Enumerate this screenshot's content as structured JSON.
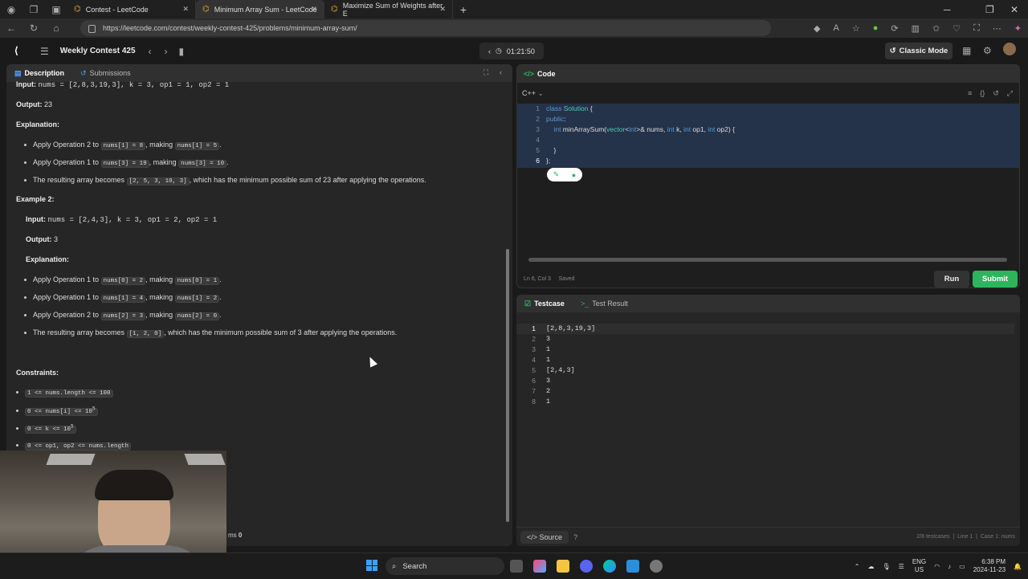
{
  "browser": {
    "tabs": [
      {
        "title": "Contest - LeetCode"
      },
      {
        "title": "Minimum Array Sum - LeetCode"
      },
      {
        "title": "Maximize Sum of Weights after E"
      }
    ],
    "url": "https://leetcode.com/contest/weekly-contest-425/problems/minimum-array-sum/"
  },
  "header": {
    "contest_title": "Weekly Contest 425",
    "timer": "01:21:50",
    "classic_mode_label": "Classic Mode"
  },
  "left_panel": {
    "tab_description": "Description",
    "tab_submissions": "Submissions",
    "top_input_label": "Input:",
    "top_input_value": "nums = [2,8,3,19,3], k = 3, op1 = 1, op2 = 1",
    "output1_label": "Output:",
    "output1_value": "23",
    "explanation_label": "Explanation:",
    "ex1_items": [
      {
        "a": "Apply Operation 2 to ",
        "c1": "nums[1] = 8",
        "b": ", making ",
        "c2": "nums[1] = 5",
        "d": "."
      },
      {
        "a": "Apply Operation 1 to ",
        "c1": "nums[3] = 19",
        "b": ", making ",
        "c2": "nums[3] = 10",
        "d": "."
      }
    ],
    "ex1_result": {
      "a": "The resulting array becomes ",
      "c": "[2, 5, 3, 10, 3]",
      "b": ", which has the minimum possible sum of 23 after applying the operations."
    },
    "example2_title": "Example 2:",
    "input2_label": "Input:",
    "input2_value": "nums = [2,4,3], k = 3, op1 = 2, op2 = 1",
    "output2_label": "Output:",
    "output2_value": "3",
    "explanation2_label": "Explanation:",
    "ex2_items": [
      {
        "a": "Apply Operation 1 to ",
        "c1": "nums[0] = 2",
        "b": ", making ",
        "c2": "nums[0] = 1",
        "d": "."
      },
      {
        "a": "Apply Operation 1 to ",
        "c1": "nums[1] = 4",
        "b": ", making ",
        "c2": "nums[1] = 2",
        "d": "."
      },
      {
        "a": "Apply Operation 2 to ",
        "c1": "nums[2] = 3",
        "b": ", making ",
        "c2": "nums[2] = 0",
        "d": "."
      }
    ],
    "ex2_result": {
      "a": "The resulting array becomes ",
      "c": "[1, 2, 0]",
      "b": ", which has the minimum possible sum of 3 after applying the operations."
    },
    "constraints_title": "Constraints:",
    "constraints": [
      "1 <= nums.length <= 100",
      "0 <= nums[i] <= 10",
      "0 <= k <= 10",
      "0 <= op1, op2 <= nums.length"
    ],
    "constraint_sup": "5",
    "footer_text": "ms",
    "footer_count": "0"
  },
  "code_panel": {
    "title": "Code",
    "language": "C++",
    "lines": [
      "1",
      "2",
      "3",
      "4",
      "5",
      "6"
    ],
    "status_position": "Ln 6, Col 3",
    "status_saved": "Saved",
    "run_label": "Run",
    "submit_label": "Submit"
  },
  "test_panel": {
    "tab_testcase": "Testcase",
    "tab_result": "Test Result",
    "lines": [
      {
        "n": "1",
        "v": "[2,8,3,19,3]"
      },
      {
        "n": "2",
        "v": "3"
      },
      {
        "n": "3",
        "v": "1"
      },
      {
        "n": "4",
        "v": "1"
      },
      {
        "n": "5",
        "v": "[2,4,3]"
      },
      {
        "n": "6",
        "v": "3"
      },
      {
        "n": "7",
        "v": "2"
      },
      {
        "n": "8",
        "v": "1"
      }
    ],
    "source_label": "Source",
    "footer_testcases": "2/8 testcases",
    "footer_line": "Line 1",
    "footer_case": "Case 1: nums"
  },
  "taskbar": {
    "search_label": "Search",
    "lang": "ENG",
    "region": "US",
    "time": "6:38 PM",
    "date": "2024-11-23"
  },
  "colors": {
    "accent_green": "#2db55d",
    "tab_orange": "#f0a020",
    "code_blue": "#569cd6"
  }
}
